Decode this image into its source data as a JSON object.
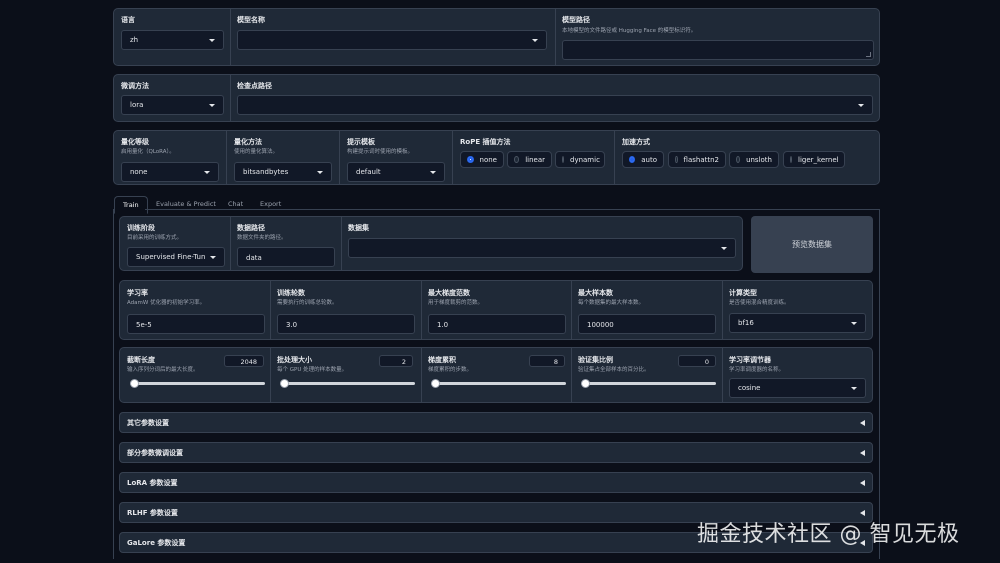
{
  "row1": {
    "lang": {
      "label": "语言",
      "value": "zh"
    },
    "model_name": {
      "label": "模型名称",
      "value": ""
    },
    "model_path": {
      "label": "模型路径",
      "info": "本地模型的文件路径或 Hugging Face 的模型标识符。",
      "value": ""
    }
  },
  "row2": {
    "finetune": {
      "label": "微调方法",
      "value": "lora"
    },
    "checkpoint": {
      "label": "检查点路径",
      "value": ""
    }
  },
  "row3": {
    "quant_bit": {
      "label": "量化等级",
      "info": "启用量化（QLoRA）。",
      "value": "none"
    },
    "quant_method": {
      "label": "量化方法",
      "info": "使用的量化算法。",
      "value": "bitsandbytes"
    },
    "template": {
      "label": "提示模板",
      "info": "构建提示词时使用的模板。",
      "value": "default"
    },
    "rope": {
      "label": "RoPE 插值方法",
      "options": [
        "none",
        "linear",
        "dynamic"
      ],
      "selected": "none"
    },
    "booster": {
      "label": "加速方式",
      "options": [
        "auto",
        "flashattn2",
        "unsloth",
        "liger_kernel"
      ],
      "selected": "auto"
    }
  },
  "tabs": [
    "Train",
    "Evaluate & Predict",
    "Chat",
    "Export"
  ],
  "active_tab": "Train",
  "train": {
    "stage": {
      "label": "训练阶段",
      "info": "目前采用的训练方式。",
      "value": "Supervised Fine-Tuning"
    },
    "dataset_dir": {
      "label": "数据路径",
      "info": "数据文件夹的路径。",
      "value": "data"
    },
    "dataset": {
      "label": "数据集",
      "value": ""
    },
    "preview_button": "预览数据集",
    "learning_rate": {
      "label": "学习率",
      "info": "AdamW 优化器的初始学习率。",
      "value": "5e-5"
    },
    "num_epochs": {
      "label": "训练轮数",
      "info": "需要执行的训练总轮数。",
      "value": "3.0"
    },
    "max_grad_norm": {
      "label": "最大梯度范数",
      "info": "用于梯度裁剪的范数。",
      "value": "1.0"
    },
    "max_samples": {
      "label": "最大样本数",
      "info": "每个数据集的最大样本数。",
      "value": "100000"
    },
    "compute_type": {
      "label": "计算类型",
      "info": "是否使用混合精度训练。",
      "value": "bf16"
    },
    "cutoff_len": {
      "label": "截断长度",
      "info": "输入序列分词后的最大长度。",
      "value": "2048",
      "slider_fraction": 0.0
    },
    "batch_size": {
      "label": "批处理大小",
      "info": "每个 GPU 处理的样本数量。",
      "value": "2",
      "slider_fraction": 0.0
    },
    "grad_accum": {
      "label": "梯度累积",
      "info": "梯度累积的步数。",
      "value": "8",
      "slider_fraction": 0.0
    },
    "val_size": {
      "label": "验证集比例",
      "info": "验证集占全部样本的百分比。",
      "value": "0",
      "slider_fraction": 0.0
    },
    "lr_scheduler": {
      "label": "学习率调节器",
      "info": "学习率调度器的名称。",
      "value": "cosine"
    },
    "accordions": [
      "其它参数设置",
      "部分参数微调设置",
      "LoRA 参数设置",
      "RLHF 参数设置",
      "GaLore 参数设置"
    ]
  },
  "watermark": "掘金技术社区 @ 智见无极"
}
